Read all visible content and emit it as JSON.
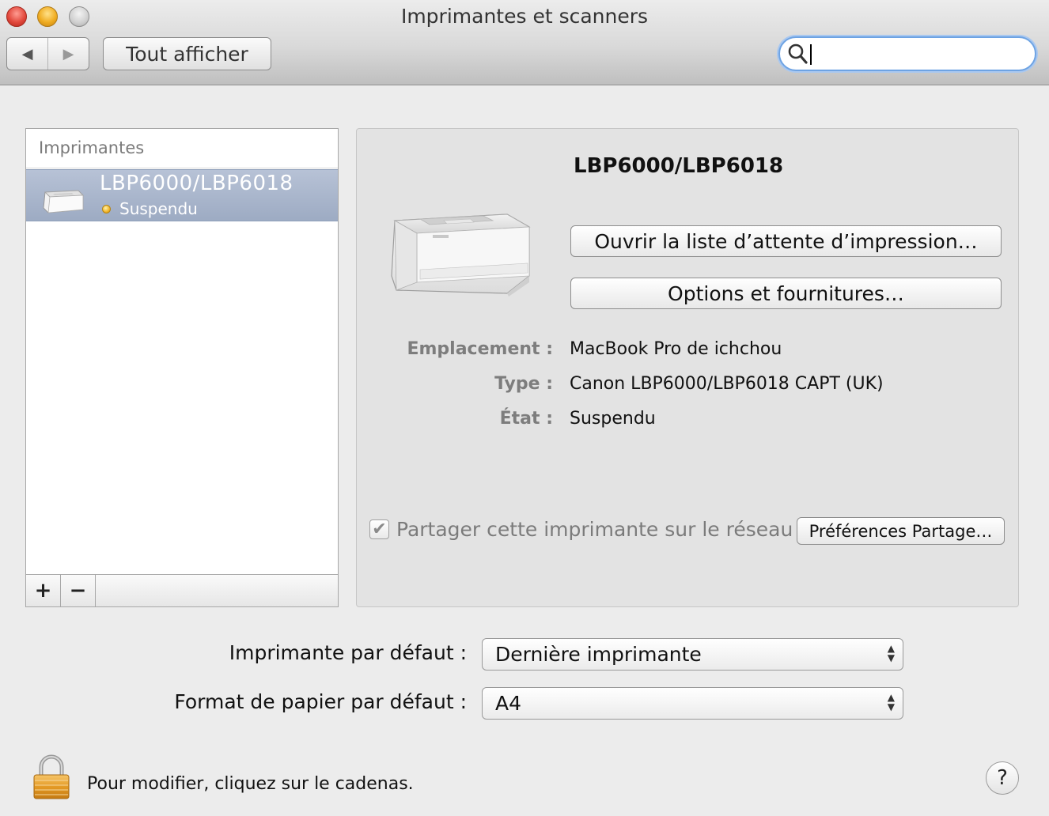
{
  "window": {
    "title": "Imprimantes et scanners"
  },
  "toolbar": {
    "back_icon": "◀",
    "forward_icon": "▶",
    "show_all_label": "Tout afficher",
    "search_icon": "search-icon",
    "search_value": ""
  },
  "printer_list": {
    "header": "Imprimantes",
    "items": [
      {
        "name": "LBP6000/LBP6018",
        "status": "Suspendu",
        "status_color": "#f1b52a"
      }
    ],
    "add_label": "+",
    "remove_label": "−"
  },
  "detail": {
    "printer_name": "LBP6000/LBP6018",
    "queue_button": "Ouvrir la liste d’attente d’impression…",
    "options_button": "Options et fournitures…",
    "location_label": "Emplacement :",
    "location_value": "MacBook Pro de ichchou",
    "type_label": "Type :",
    "type_value": "Canon LBP6000/LBP6018 CAPT (UK)",
    "state_label": "État :",
    "state_value": "Suspendu",
    "share_checked": true,
    "share_label": "Partager cette imprimante sur le réseau",
    "share_prefs_button": "Préférences Partage…"
  },
  "defaults": {
    "default_printer_label": "Imprimante par défaut :",
    "default_printer_value": "Dernière imprimante",
    "paper_label": "Format de papier par défaut :",
    "paper_value": "A4"
  },
  "footer": {
    "lock_text": "Pour modifier, cliquez sur le cadenas.",
    "help_label": "?"
  },
  "colors": {
    "selection": "#a6b3ca",
    "search_focus": "#6ea3e3"
  }
}
